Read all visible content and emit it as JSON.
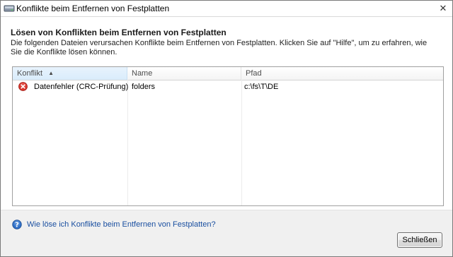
{
  "window": {
    "title": "Konflikte beim Entfernen von Festplatten",
    "close_label": "✕"
  },
  "main": {
    "heading": "Lösen von Konflikten beim Entfernen von Festplatten",
    "description": "Die folgenden Dateien verursachen Konflikte beim Entfernen von Festplatten. Klicken Sie auf \"Hilfe\", um zu erfahren, wie Sie die Konflikte lösen können."
  },
  "table": {
    "columns": [
      "Konflikt",
      "Name",
      "Pfad"
    ],
    "sort_column": "Konflikt",
    "sort_direction": "ascending",
    "rows": [
      {
        "icon": "error-icon",
        "conflict": "Datenfehler (CRC-Prüfung)",
        "name": "folders",
        "path": "c:\\fs\\T\\DE"
      }
    ]
  },
  "footer": {
    "help_link": "Wie löse ich Konflikte beim Entfernen von Festplatten?",
    "close_button": "Schließen"
  },
  "colors": {
    "link": "#1a4fa0",
    "error": "#d9342b",
    "help": "#2f6fc7"
  }
}
